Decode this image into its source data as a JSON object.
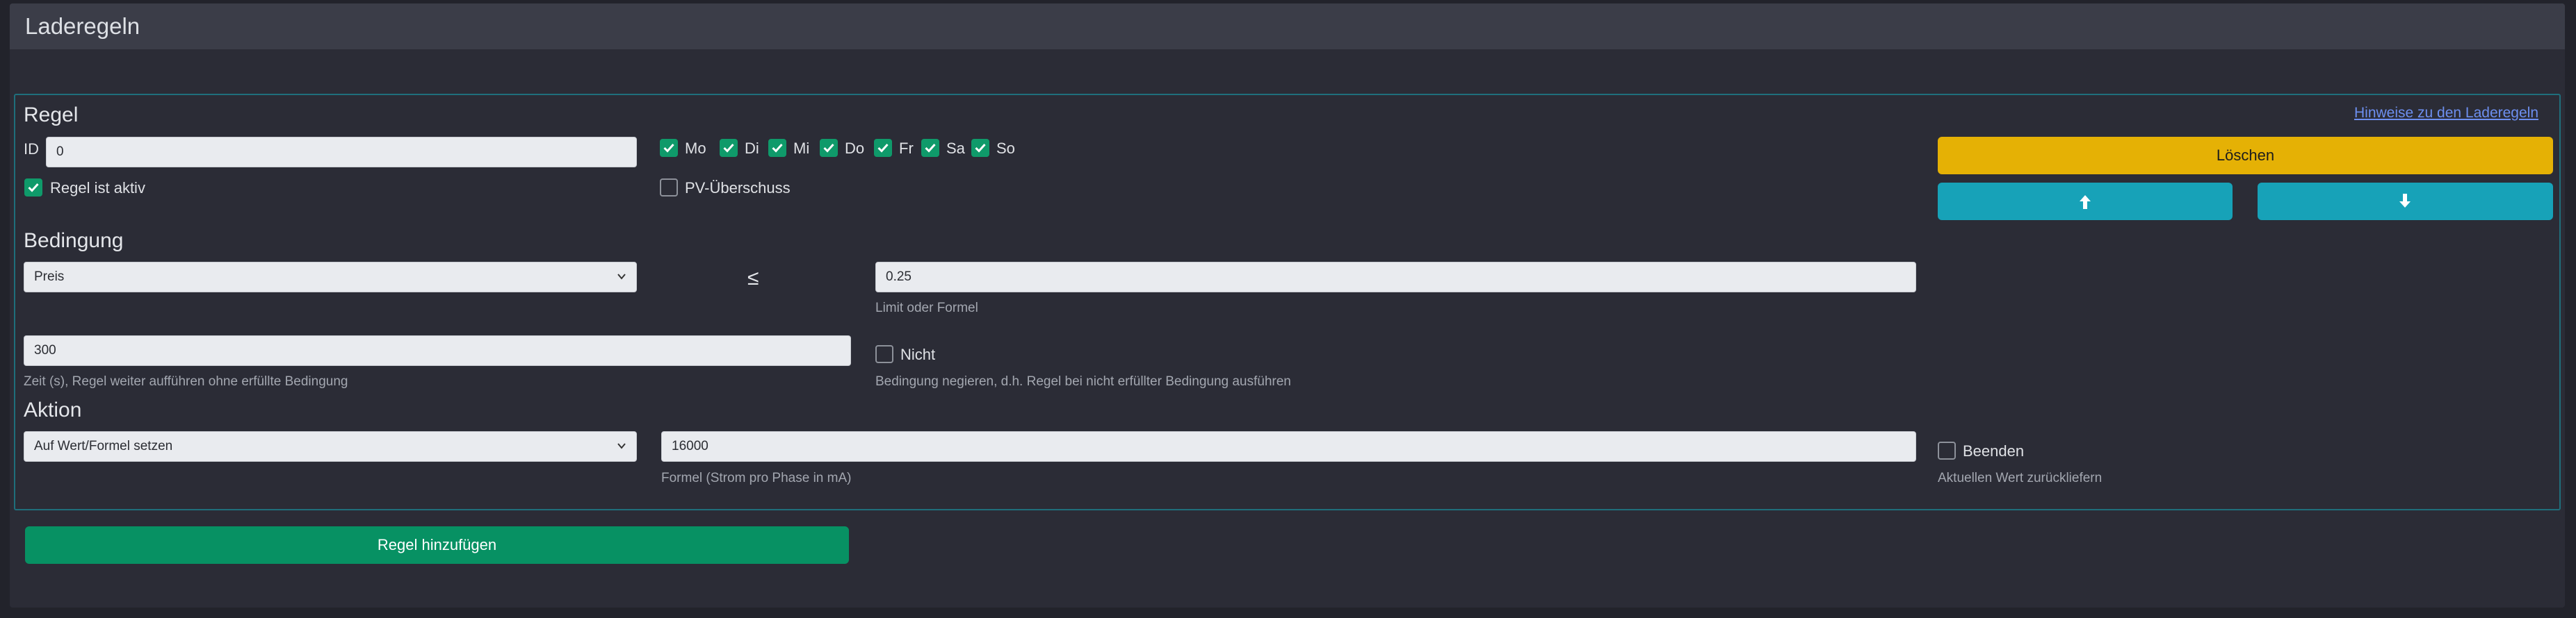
{
  "header": {
    "title": "Laderegeln"
  },
  "rule": {
    "heading": "Regel",
    "help_link": "Hinweise zu den Laderegeln",
    "id_label": "ID",
    "id_value": "0",
    "active_label": "Regel ist aktiv",
    "active_checked": true,
    "days": [
      {
        "label": "Mo",
        "checked": true
      },
      {
        "label": "Di",
        "checked": true
      },
      {
        "label": "Mi",
        "checked": true
      },
      {
        "label": "Do",
        "checked": true
      },
      {
        "label": "Fr",
        "checked": true
      },
      {
        "label": "Sa",
        "checked": true
      },
      {
        "label": "So",
        "checked": true
      }
    ],
    "pv_label": "PV-Überschuss",
    "pv_checked": false,
    "delete_label": "Löschen",
    "up_icon": "arrow-up-icon",
    "down_icon": "arrow-down-icon"
  },
  "condition": {
    "heading": "Bedingung",
    "type_value": "Preis",
    "operator": "≤",
    "limit_value": "0.25",
    "limit_hint": "Limit oder Formel",
    "time_value": "300",
    "time_hint": "Zeit (s), Regel weiter aufführen ohne erfüllte Bedingung",
    "negate_label": "Nicht",
    "negate_checked": false,
    "negate_hint": "Bedingung negieren, d.h. Regel bei nicht erfüllter Bedingung ausführen"
  },
  "action": {
    "heading": "Aktion",
    "type_value": "Auf Wert/Formel setzen",
    "formula_value": "16000",
    "formula_hint": "Formel (Strom pro Phase in mA)",
    "stop_label": "Beenden",
    "stop_checked": false,
    "stop_hint": "Aktuellen Wert zurückliefern"
  },
  "add_button_label": "Regel hinzufügen",
  "colors": {
    "background": "#22232b",
    "panel": "#2b2c36",
    "header": "#3b3d48",
    "checkbox": "#0f9a6a",
    "delete": "#e5b105",
    "move": "#17a2b8",
    "add": "#079163"
  }
}
